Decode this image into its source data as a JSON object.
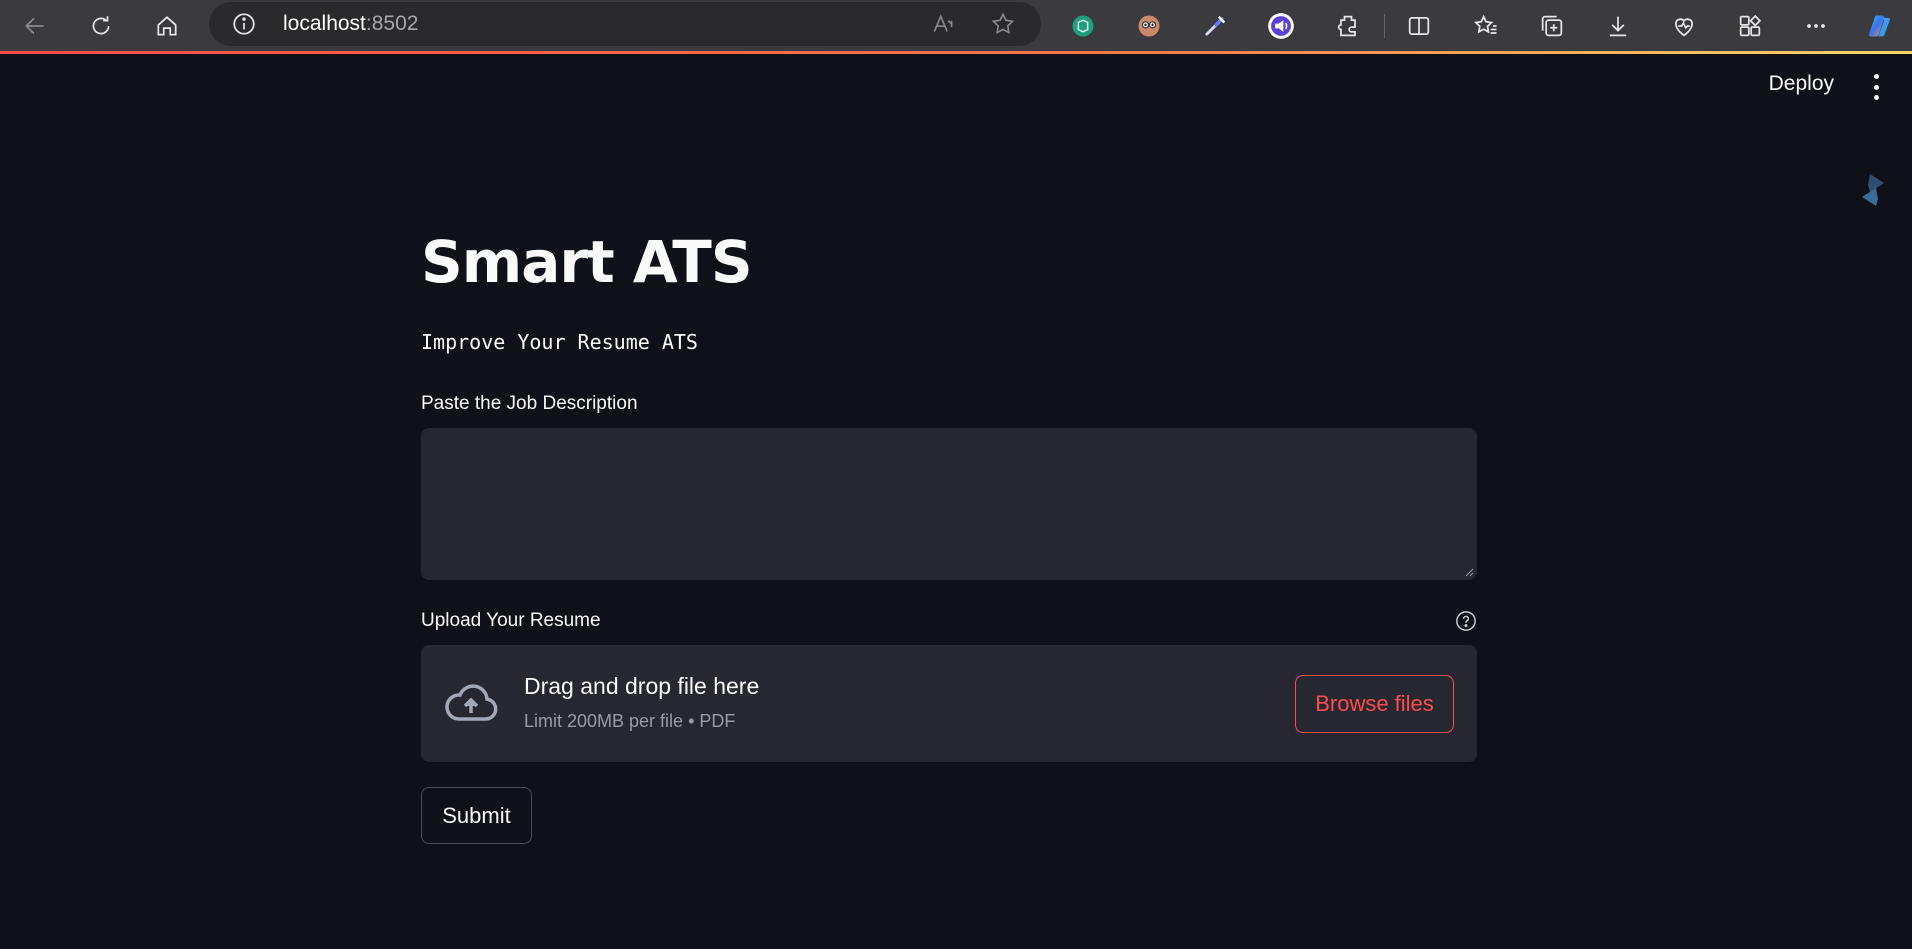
{
  "browser": {
    "url_host": "localhost",
    "url_port": ":8502"
  },
  "header": {
    "deploy_label": "Deploy"
  },
  "main": {
    "title": "Smart ATS",
    "subtitle": "Improve Your Resume ATS",
    "job_description": {
      "label": "Paste the Job Description",
      "value": "",
      "placeholder": ""
    },
    "resume_upload": {
      "label": "Upload Your Resume",
      "dropzone_title": "Drag and drop file here",
      "dropzone_limit": "Limit 200MB per file • PDF",
      "browse_label": "Browse files"
    },
    "submit_label": "Submit"
  },
  "colors": {
    "background": "#0e1117",
    "input_background": "#262730",
    "accent": "#ff4b4b",
    "text": "#fafafa"
  },
  "icons": [
    "back-icon",
    "refresh-icon",
    "home-icon",
    "info-icon",
    "read-aloud-icon",
    "favorite-star-icon",
    "chatgpt-extension-icon",
    "avatar-extension-icon",
    "eyedropper-extension-icon",
    "audio-extension-icon",
    "extensions-icon",
    "split-screen-icon",
    "favorites-icon",
    "collections-icon",
    "downloads-icon",
    "browser-essentials-icon",
    "apps-icon",
    "more-icon",
    "copilot-icon",
    "cloud-upload-icon",
    "help-icon",
    "streamlit-logo-icon"
  ]
}
